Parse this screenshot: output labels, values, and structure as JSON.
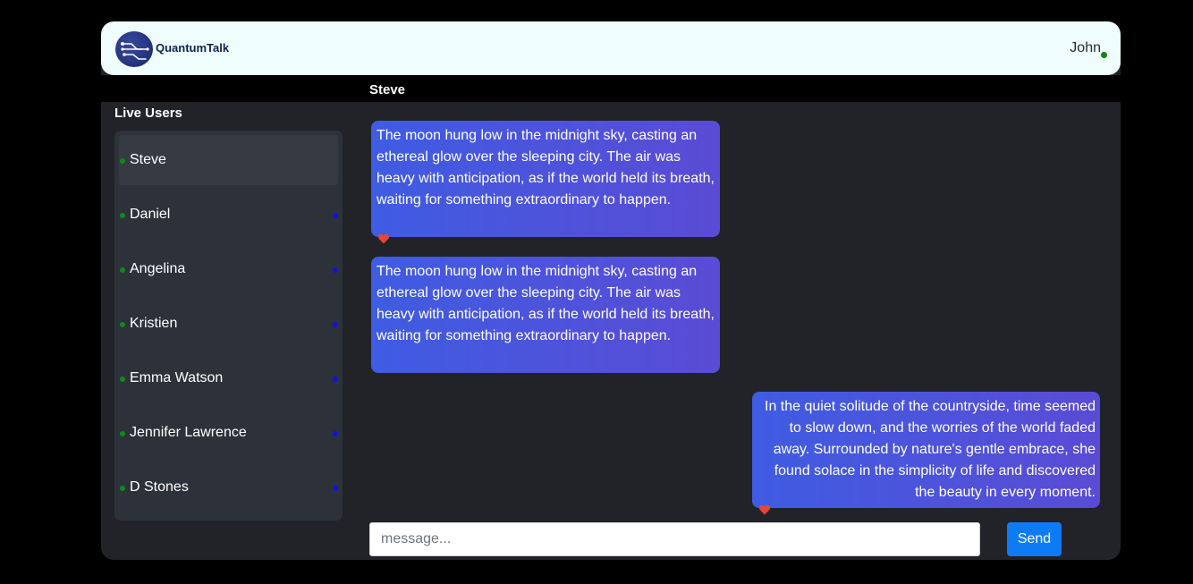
{
  "header": {
    "brand": "QuantumTalk",
    "current_user": "John"
  },
  "chat": {
    "title": "Steve"
  },
  "sidebar": {
    "title": "Live Users",
    "users": [
      {
        "name": "Steve"
      },
      {
        "name": "Daniel"
      },
      {
        "name": "Angelina"
      },
      {
        "name": "Kristien"
      },
      {
        "name": "Emma Watson"
      },
      {
        "name": "Jennifer Lawrence"
      },
      {
        "name": "D Stones"
      }
    ]
  },
  "messages": [
    {
      "text": " The moon hung low in the midnight sky, casting an ethereal glow over the sleeping city. The air was heavy with anticipation, as if the world held its breath, waiting for something extraordinary to happen."
    },
    {
      "text": " The moon hung low in the midnight sky, casting an ethereal glow over the sleeping city. The air was heavy with anticipation, as if the world held its breath, waiting for something extraordinary to happen."
    },
    {
      "text": "In the quiet solitude of the countryside, time seemed to slow down, and the worries of the world faded away. Surrounded by nature's gentle embrace, she found solace in the simplicity of life and discovered the beauty in every moment. "
    }
  ],
  "composer": {
    "placeholder": "message...",
    "send_label": "Send"
  },
  "colors": {
    "online": "#13820f",
    "unread": "#1010e8",
    "heart": "#e8443a",
    "send": "#0d7bf5"
  },
  "icons": {
    "logo": "circuit-logo-icon",
    "reaction": "heart-icon"
  }
}
